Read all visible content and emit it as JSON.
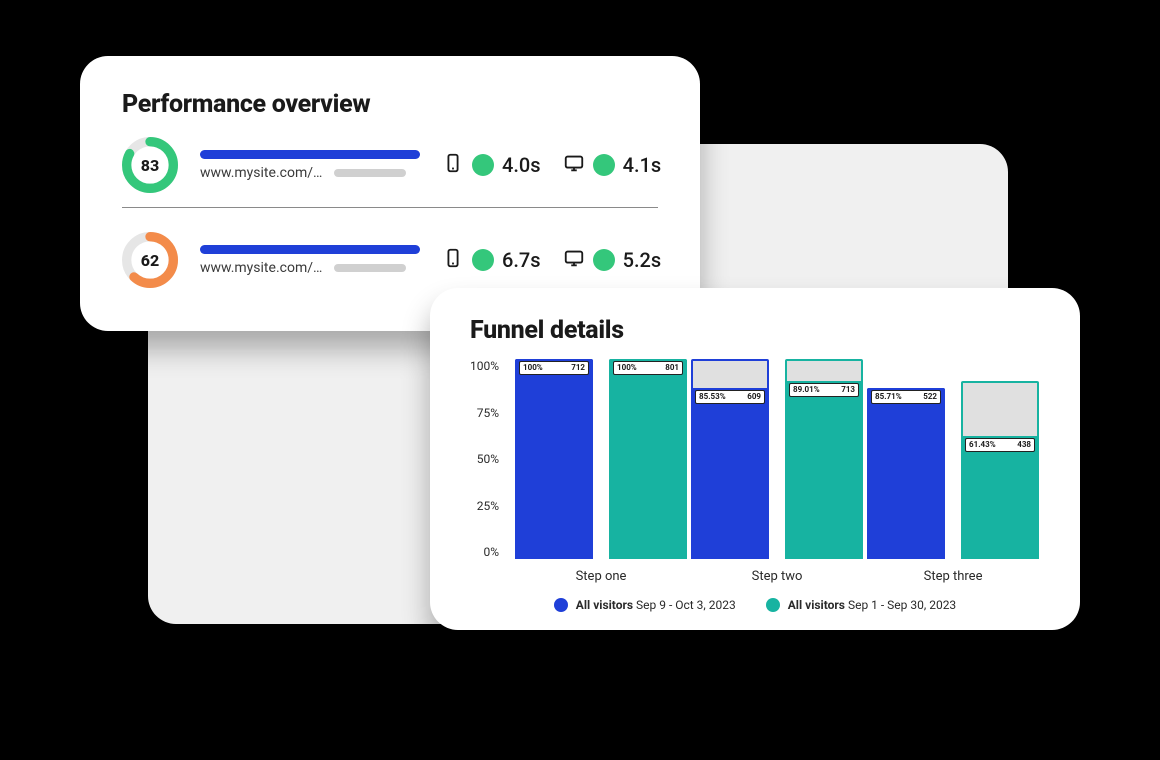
{
  "performance": {
    "title": "Performance overview",
    "rows": [
      {
        "score": "83",
        "score_color": "#34c77b",
        "score_pct": 83,
        "url": "www.mysite.com/…",
        "mobile_time": "4.0s",
        "desktop_time": "4.1s"
      },
      {
        "score": "62",
        "score_color": "#f38b4a",
        "score_pct": 62,
        "url": "www.mysite.com/…",
        "mobile_time": "6.7s",
        "desktop_time": "5.2s"
      }
    ]
  },
  "funnel": {
    "title": "Funnel details",
    "yticks": [
      "100%",
      "75%",
      "50%",
      "25%",
      "0%"
    ],
    "categories": [
      "Step one",
      "Step two",
      "Step three"
    ],
    "legend": [
      {
        "name": "All visitors",
        "range": "Sep 9 - Oct 3, 2023"
      },
      {
        "name": "All visitors",
        "range": "Sep 1 - Sep 30, 2023"
      }
    ],
    "bars": [
      {
        "a": {
          "pct": 100,
          "pct_label": "100%",
          "count": "712",
          "outline_pct": 100
        },
        "b": {
          "pct": 100,
          "pct_label": "100%",
          "count": "801",
          "outline_pct": 100
        }
      },
      {
        "a": {
          "pct": 85.53,
          "pct_label": "85.53%",
          "count": "609",
          "outline_pct": 100
        },
        "b": {
          "pct": 89.01,
          "pct_label": "89.01%",
          "count": "713",
          "outline_pct": 100
        }
      },
      {
        "a": {
          "pct": 85.71,
          "pct_label": "85.71%",
          "count": "522",
          "outline_pct": 85.53
        },
        "b": {
          "pct": 61.43,
          "pct_label": "61.43%",
          "count": "438",
          "outline_pct": 89.01
        }
      }
    ]
  },
  "chart_data": {
    "type": "bar",
    "title": "Funnel details",
    "ylabel": "percent",
    "ylim": [
      0,
      100
    ],
    "categories": [
      "Step one",
      "Step two",
      "Step three"
    ],
    "series": [
      {
        "name": "All visitors Sep 9 - Oct 3, 2023",
        "values_pct": [
          100,
          85.53,
          85.71
        ],
        "values_count": [
          712,
          609,
          522
        ],
        "bar_outline_pct": [
          100,
          100,
          85.53
        ]
      },
      {
        "name": "All visitors Sep 1 - Sep 30, 2023",
        "values_pct": [
          100,
          89.01,
          61.43
        ],
        "values_count": [
          801,
          713,
          438
        ],
        "bar_outline_pct": [
          100,
          100,
          89.01
        ]
      }
    ],
    "notes": "values_count shown as data labels on bars; bar_outline_pct is the prior-step height drawn as a hollow outline behind each filled bar."
  },
  "colors": {
    "series_a": "#1f3fd8",
    "series_b": "#17b3a1",
    "good": "#34c77b",
    "warn": "#f38b4a"
  }
}
